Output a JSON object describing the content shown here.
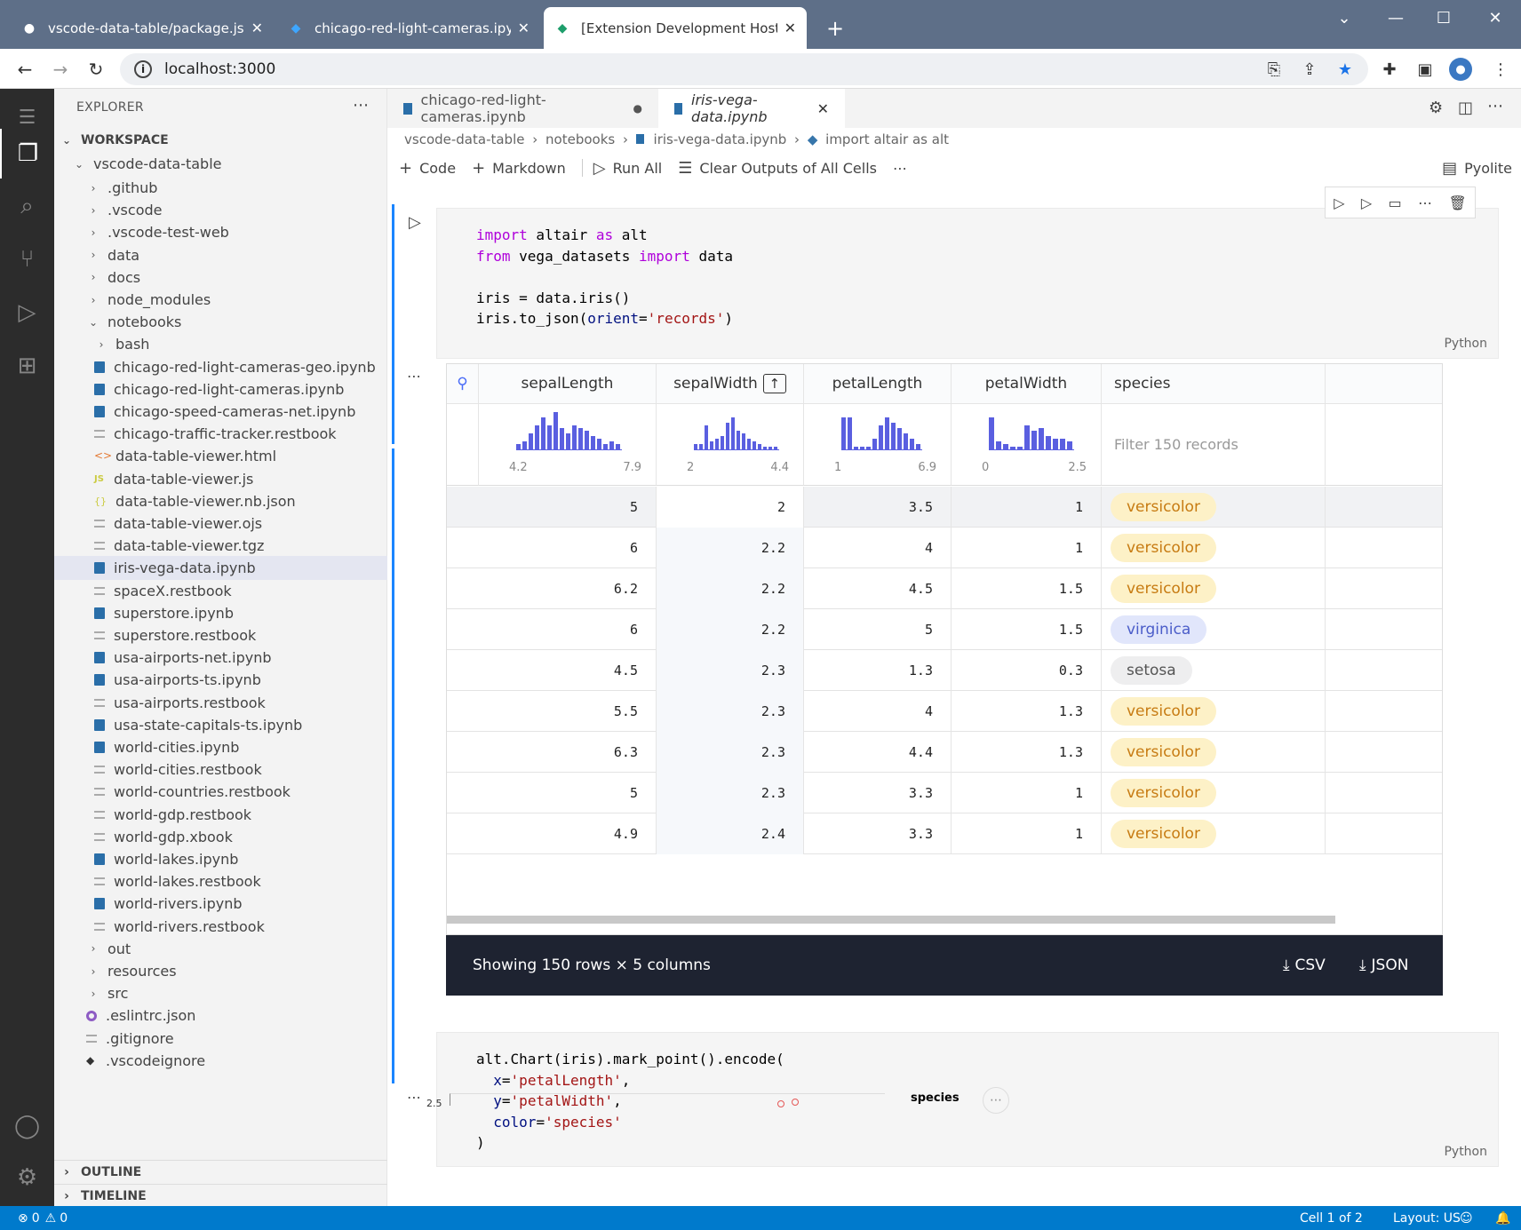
{
  "browser": {
    "tabs": [
      {
        "title": "vscode-data-table/package.json"
      },
      {
        "title": "chicago-red-light-cameras.ipynb"
      },
      {
        "title": "[Extension Development Host] - "
      }
    ],
    "url": "localhost:3000"
  },
  "explorer": {
    "title": "EXPLORER",
    "workspace": "WORKSPACE",
    "root": "vscode-data-table",
    "items": [
      {
        "label": ".github",
        "type": "folder",
        "depth": 1
      },
      {
        "label": ".vscode",
        "type": "folder",
        "depth": 1
      },
      {
        "label": ".vscode-test-web",
        "type": "folder",
        "depth": 1
      },
      {
        "label": "data",
        "type": "folder",
        "depth": 1
      },
      {
        "label": "docs",
        "type": "folder",
        "depth": 1
      },
      {
        "label": "node_modules",
        "type": "folder",
        "depth": 1
      },
      {
        "label": "notebooks",
        "type": "folder-open",
        "depth": 1
      },
      {
        "label": "bash",
        "type": "folder",
        "depth": 2
      },
      {
        "label": "chicago-red-light-cameras-geo.ipynb",
        "type": "nb",
        "depth": 2
      },
      {
        "label": "chicago-red-light-cameras.ipynb",
        "type": "nb",
        "depth": 2
      },
      {
        "label": "chicago-speed-cameras-net.ipynb",
        "type": "nb",
        "depth": 2
      },
      {
        "label": "chicago-traffic-tracker.restbook",
        "type": "txt",
        "depth": 2
      },
      {
        "label": "data-table-viewer.html",
        "type": "html",
        "depth": 2
      },
      {
        "label": "data-table-viewer.js",
        "type": "js",
        "depth": 2
      },
      {
        "label": "data-table-viewer.nb.json",
        "type": "json",
        "depth": 2
      },
      {
        "label": "data-table-viewer.ojs",
        "type": "txt",
        "depth": 2
      },
      {
        "label": "data-table-viewer.tgz",
        "type": "txt",
        "depth": 2
      },
      {
        "label": "iris-vega-data.ipynb",
        "type": "nb",
        "depth": 2,
        "selected": true
      },
      {
        "label": "spaceX.restbook",
        "type": "txt",
        "depth": 2
      },
      {
        "label": "superstore.ipynb",
        "type": "nb",
        "depth": 2
      },
      {
        "label": "superstore.restbook",
        "type": "txt",
        "depth": 2
      },
      {
        "label": "usa-airports-net.ipynb",
        "type": "nb",
        "depth": 2
      },
      {
        "label": "usa-airports-ts.ipynb",
        "type": "nb",
        "depth": 2
      },
      {
        "label": "usa-airports.restbook",
        "type": "txt",
        "depth": 2
      },
      {
        "label": "usa-state-capitals-ts.ipynb",
        "type": "nb",
        "depth": 2
      },
      {
        "label": "world-cities.ipynb",
        "type": "nb",
        "depth": 2
      },
      {
        "label": "world-cities.restbook",
        "type": "txt",
        "depth": 2
      },
      {
        "label": "world-countries.restbook",
        "type": "txt",
        "depth": 2
      },
      {
        "label": "world-gdp.restbook",
        "type": "txt",
        "depth": 2
      },
      {
        "label": "world-gdp.xbook",
        "type": "txt",
        "depth": 2
      },
      {
        "label": "world-lakes.ipynb",
        "type": "nb",
        "depth": 2
      },
      {
        "label": "world-lakes.restbook",
        "type": "txt",
        "depth": 2
      },
      {
        "label": "world-rivers.ipynb",
        "type": "nb",
        "depth": 2
      },
      {
        "label": "world-rivers.restbook",
        "type": "txt",
        "depth": 2
      },
      {
        "label": "out",
        "type": "folder",
        "depth": 1
      },
      {
        "label": "resources",
        "type": "folder",
        "depth": 1
      },
      {
        "label": "src",
        "type": "folder",
        "depth": 1
      },
      {
        "label": ".eslintrc.json",
        "type": "eslint",
        "depth": 1
      },
      {
        "label": ".gitignore",
        "type": "txt",
        "depth": 1
      },
      {
        "label": ".vscodeignore",
        "type": "git",
        "depth": 1
      }
    ],
    "outline": "OUTLINE",
    "timeline": "TIMELINE"
  },
  "editor": {
    "tabs": [
      {
        "label": "chicago-red-light-cameras.ipynb"
      },
      {
        "label": "iris-vega-data.ipynb"
      }
    ],
    "breadcrumb": [
      "vscode-data-table",
      "notebooks",
      "iris-vega-data.ipynb",
      "import altair as alt"
    ],
    "toolbar": {
      "code": "Code",
      "markdown": "Markdown",
      "run_all": "Run All",
      "clear": "Clear Outputs of All Cells",
      "kernel": "Pyolite"
    },
    "cell1_lang": "Python",
    "cell2_lang": "Python"
  },
  "table": {
    "columns": [
      "sepalLength",
      "sepalWidth",
      "petalLength",
      "petalWidth",
      "species"
    ],
    "hist_ranges": [
      [
        "4.2",
        "7.9"
      ],
      [
        "2",
        "4.4"
      ],
      [
        "1",
        "6.9"
      ],
      [
        "0",
        "2.5"
      ]
    ],
    "filter_placeholder": "Filter 150 records",
    "rows": [
      [
        "5",
        "2",
        "3.5",
        "1",
        "versicolor"
      ],
      [
        "6",
        "2.2",
        "4",
        "1",
        "versicolor"
      ],
      [
        "6.2",
        "2.2",
        "4.5",
        "1.5",
        "versicolor"
      ],
      [
        "6",
        "2.2",
        "5",
        "1.5",
        "virginica"
      ],
      [
        "4.5",
        "2.3",
        "1.3",
        "0.3",
        "setosa"
      ],
      [
        "5.5",
        "2.3",
        "4",
        "1.3",
        "versicolor"
      ],
      [
        "6.3",
        "2.3",
        "4.4",
        "1.3",
        "versicolor"
      ],
      [
        "5",
        "2.3",
        "3.3",
        "1",
        "versicolor"
      ],
      [
        "4.9",
        "2.4",
        "3.3",
        "1",
        "versicolor"
      ]
    ],
    "footer": "Showing 150 rows × 5 columns",
    "csv": "CSV",
    "json": "JSON"
  },
  "chart_peek": {
    "y_tick": "2.5",
    "legend_title": "species"
  },
  "status": {
    "errors": "0",
    "warnings": "0",
    "cell": "Cell 1 of 2",
    "layout": "Layout: US"
  }
}
